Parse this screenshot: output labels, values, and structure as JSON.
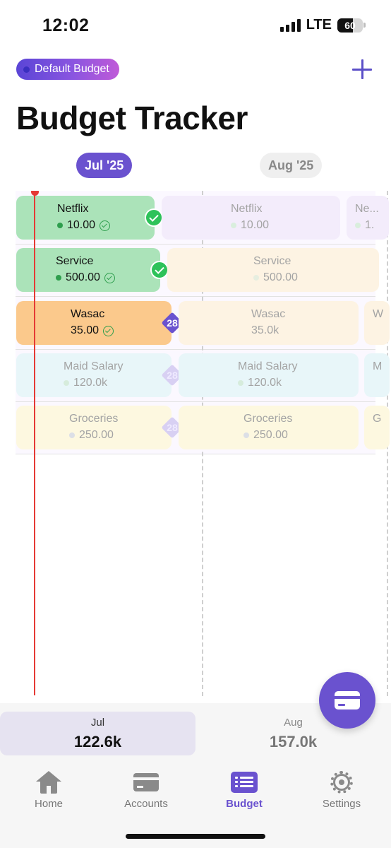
{
  "status_bar": {
    "time": "12:02",
    "network": "LTE",
    "battery": "60"
  },
  "header": {
    "budget_pill": "Default Budget",
    "title": "Budget Tracker"
  },
  "months": [
    {
      "label": "Jul '25",
      "selected": true
    },
    {
      "label": "Aug '25",
      "selected": false
    }
  ],
  "timeline": {
    "rows": [
      {
        "jul": {
          "name": "Netflix",
          "amount": "10.00"
        },
        "aug": {
          "name": "Netflix",
          "amount": "10.00"
        },
        "sep": {
          "name": "Ne...",
          "amount": "1."
        }
      },
      {
        "jul": {
          "name": "Service",
          "amount": "500.00"
        },
        "aug": {
          "name": "Service",
          "amount": "500.00"
        }
      },
      {
        "jul": {
          "name": "Wasac",
          "amount": "35.00",
          "due_day": "28"
        },
        "aug": {
          "name": "Wasac",
          "amount": "35.0k"
        },
        "sep": {
          "name": "W",
          "amount": ""
        }
      },
      {
        "jul": {
          "name": "Maid Salary",
          "amount": "120.0k",
          "due_day": "28"
        },
        "aug": {
          "name": "Maid Salary",
          "amount": "120.0k"
        },
        "sep": {
          "name": "M",
          "amount": ""
        }
      },
      {
        "jul": {
          "name": "Groceries",
          "amount": "250.00",
          "due_day": "28"
        },
        "aug": {
          "name": "Groceries",
          "amount": "250.00"
        },
        "sep": {
          "name": "G",
          "amount": ""
        }
      }
    ]
  },
  "totals": [
    {
      "month": "Jul",
      "value": "122.6k"
    },
    {
      "month": "Aug",
      "value": "157.0k"
    }
  ],
  "tabs": [
    {
      "label": "Home",
      "icon": "home-icon"
    },
    {
      "label": "Accounts",
      "icon": "card-icon"
    },
    {
      "label": "Budget",
      "icon": "list-icon",
      "active": true
    },
    {
      "label": "Settings",
      "icon": "gear-icon"
    }
  ],
  "colors": {
    "accent": "#6a52cf",
    "paid_green": "#abe3b9",
    "due_orange": "#fbc98c",
    "current_line": "#e53935"
  }
}
